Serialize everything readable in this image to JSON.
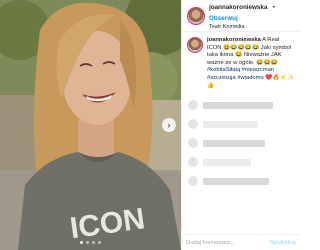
{
  "header": {
    "username": "joannakoroniewska",
    "separator": "•",
    "follow_label": "Obserwuj",
    "location": "Teatr Komedia"
  },
  "caption": {
    "username": "joannakoroniewska",
    "text_part1": "A Real ICON 😆😂😂😂😂 Jaki symbol taka ikona 😂 Nieważne JAK ważne że w ogóle. 😂😂😂",
    "hashtags": "#kobitaSiłatą #niewzcman #szczesuja #wiadomo",
    "emoji_tail": "❤️🔥⚡️✨👍"
  },
  "footer": {
    "comment_placeholder": "Dodaj komentarz...",
    "publish_label": "Opublikuj"
  },
  "photo": {
    "shirt_text": "ICON",
    "carousel_arrow": "›"
  },
  "colors": {
    "follow": "#0095f6",
    "shirt": "#6f7166",
    "hair": "#c79a5c"
  }
}
